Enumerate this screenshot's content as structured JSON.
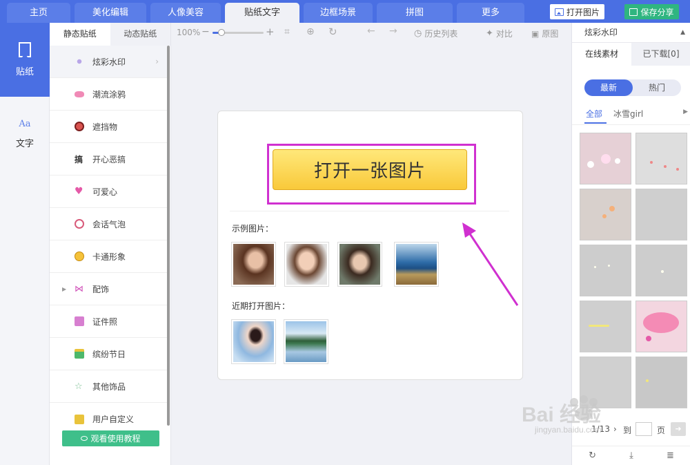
{
  "topnav": {
    "tabs": [
      {
        "label": "主页"
      },
      {
        "label": "美化编辑"
      },
      {
        "label": "人像美容"
      },
      {
        "label": "贴纸文字"
      },
      {
        "label": "边框场景"
      },
      {
        "label": "拼图"
      },
      {
        "label": "更多"
      }
    ],
    "open_image_label": "打开图片",
    "save_share_label": "保存分享",
    "accent_color": "#4a6fe3",
    "save_color": "#2fb580"
  },
  "rail": {
    "items": [
      {
        "label": "贴纸",
        "icon": "bookmark-icon"
      },
      {
        "label": "文字",
        "icon": "aa-text-icon",
        "glyph": "Aa"
      }
    ]
  },
  "catpanel": {
    "subtabs": [
      {
        "label": "静态贴纸"
      },
      {
        "label": "动态贴纸"
      }
    ],
    "categories": [
      {
        "label": "炫彩水印",
        "icon": "sparkle-icon"
      },
      {
        "label": "潮流涂鸦",
        "icon": "lips-icon"
      },
      {
        "label": "遮挡物",
        "icon": "mask-icon"
      },
      {
        "label": "开心恶搞",
        "icon": "gao-char-icon",
        "glyph": "搞"
      },
      {
        "label": "可爱心",
        "icon": "heart-icon"
      },
      {
        "label": "会话气泡",
        "icon": "speech-bubble-icon"
      },
      {
        "label": "卡通形象",
        "icon": "cartoon-face-icon"
      },
      {
        "label": "配饰",
        "icon": "bow-icon"
      },
      {
        "label": "证件照",
        "icon": "shirt-icon"
      },
      {
        "label": "缤纷节日",
        "icon": "gift-icon"
      },
      {
        "label": "其他饰品",
        "icon": "star-icon"
      },
      {
        "label": "用户自定义",
        "icon": "folder-plus-icon"
      }
    ],
    "watch_tutorial_label": "观看使用教程"
  },
  "toolbar": {
    "zoom_label": "100%",
    "minus": "−",
    "plus": "+",
    "history_label": "历史列表",
    "compare_label": "对比",
    "original_label": "原图"
  },
  "main": {
    "open_button_label": "打开一张图片",
    "sample_label": "示例图片：",
    "recent_label": "近期打开图片：",
    "samples": [
      {
        "name": "portrait-girl-dark-hair"
      },
      {
        "name": "portrait-woman"
      },
      {
        "name": "portrait-child"
      },
      {
        "name": "reeds-by-sea"
      }
    ],
    "recent": [
      {
        "name": "girl-in-blue-dress"
      },
      {
        "name": "lake-reflection"
      }
    ],
    "highlight_color": "#d030d0"
  },
  "rpanel": {
    "select_value": "炫彩水印",
    "tabs": [
      {
        "label": "在线素材"
      },
      {
        "label": "已下载[0]"
      }
    ],
    "sort_options": [
      {
        "label": "最新"
      },
      {
        "label": "热门"
      }
    ],
    "filters": [
      {
        "label": "全部"
      },
      {
        "label": "冰雪girl"
      }
    ],
    "pager": {
      "current": "1/13",
      "to_label": "到",
      "page_label": "页"
    }
  },
  "watermark": {
    "brand": "Bai 经验",
    "url": "jingyan.baidu.com"
  }
}
